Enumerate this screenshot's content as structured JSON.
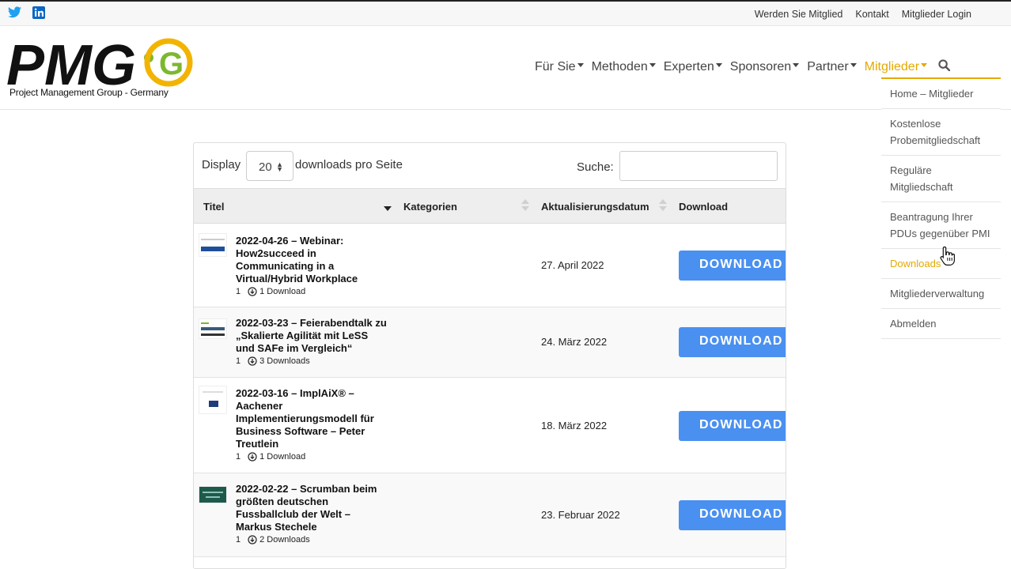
{
  "top_nav": [
    "Werden Sie Mitglied",
    "Kontakt",
    "Mitglieder Login"
  ],
  "logo": {
    "text": "PMG",
    "letter": "G",
    "subtitle": "Project Management Group - Germany"
  },
  "main_nav": [
    {
      "label": "Für Sie",
      "active": false
    },
    {
      "label": "Methoden",
      "active": false
    },
    {
      "label": "Experten",
      "active": false
    },
    {
      "label": "Sponsoren",
      "active": false
    },
    {
      "label": "Partner",
      "active": false
    },
    {
      "label": "Mitglieder",
      "active": true
    }
  ],
  "dropdown": [
    {
      "label": "Home – Mitglieder"
    },
    {
      "label": "Kostenlose Probemitgliedschaft"
    },
    {
      "label": "Reguläre Mitgliedschaft"
    },
    {
      "label": "Beantragung Ihrer PDUs gegenüber PMI"
    },
    {
      "label": "Downloads"
    },
    {
      "label": "Mitgliederverwaltung"
    },
    {
      "label": "Abmelden"
    }
  ],
  "table_controls": {
    "display_label": "Display",
    "per_page_value": "20",
    "per_page_suffix": "downloads pro Seite",
    "search_label": "Suche:",
    "search_value": ""
  },
  "columns": [
    "Titel",
    "Kategorien",
    "Aktualisierungsdatum",
    "Download"
  ],
  "rows": [
    {
      "title": "2022-04-26 – Webinar: How2succeed in Communicating in a Virtual/Hybrid Workplace",
      "version": "1",
      "downloads": "1 Download",
      "date": "27. April 2022",
      "button": "DOWNLOAD"
    },
    {
      "title": "2022-03-23 – Feierabendtalk zu „Skalierte Agilität mit LeSS und SAFe im Vergleich“",
      "version": "1",
      "downloads": "3 Downloads",
      "date": "24. März 2022",
      "button": "DOWNLOAD"
    },
    {
      "title": "2022-03-16 – ImplAiX® – Aachener Implementierungsmodell für Business Software – Peter Treutlein",
      "version": "1",
      "downloads": "1 Download",
      "date": "18. März 2022",
      "button": "DOWNLOAD"
    },
    {
      "title": "2022-02-22 – Scrumban beim größten deutschen Fussballclub der Welt – Markus Stechele",
      "version": "1",
      "downloads": "2 Downloads",
      "date": "23. Februar 2022",
      "button": "DOWNLOAD"
    }
  ],
  "colors": {
    "accent": "#e4a900",
    "button": "#4a90f0",
    "logo_green": "#7cb82f",
    "twitter": "#1da1f2",
    "linkedin": "#0a66c2"
  }
}
